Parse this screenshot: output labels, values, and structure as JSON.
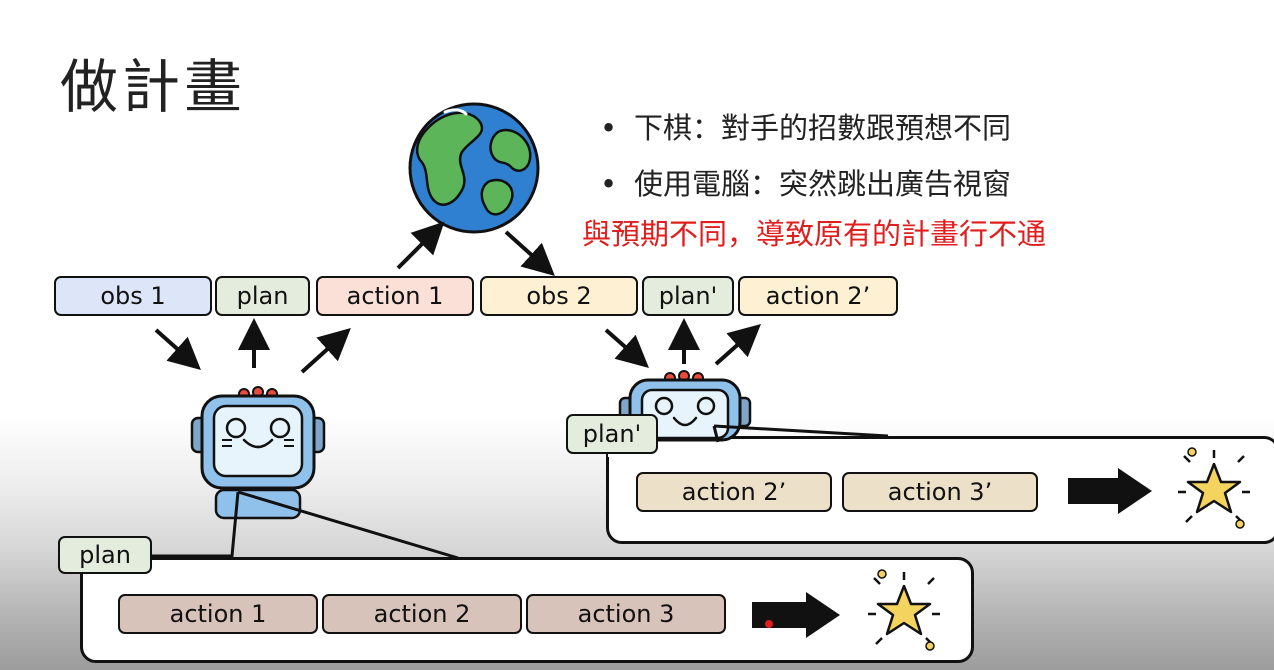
{
  "title": "做計畫",
  "bullets": [
    "下棋：對手的招數跟預想不同",
    "使用電腦：突然跳出廣告視窗"
  ],
  "note": "與預期不同，導致原有的計畫行不通",
  "sequence_left": {
    "obs": "obs 1",
    "plan": "plan",
    "action": "action 1"
  },
  "sequence_right": {
    "obs": "obs 2",
    "plan": "plan'",
    "action": "action 2’"
  },
  "plan_top": {
    "tag": "plan'",
    "actions": [
      "action 2’",
      "action 3’"
    ]
  },
  "plan_bottom": {
    "tag": "plan",
    "actions": [
      "action 1",
      "action 2",
      "action 3"
    ]
  },
  "colors": {
    "obs1": "#dde6f8",
    "plan": "#e3ecdd",
    "action1": "#fbe0d8",
    "obs2": "#fdf0d3",
    "plan_prime": "#e3ecdd",
    "action2prime": "#fdf0d3",
    "plan_action_top": "#ede0c8",
    "plan_action_bottom": "#d8c3bb",
    "note": "#e01e1e"
  },
  "icons": [
    "earth-icon",
    "robot-icon",
    "arrow-right-icon",
    "star-icon"
  ]
}
